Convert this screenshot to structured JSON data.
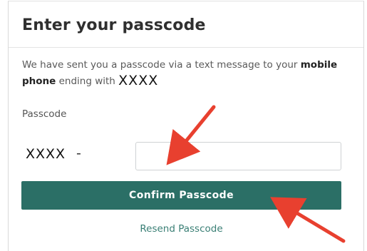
{
  "dialog": {
    "title": "Enter your passcode",
    "message_prefix": "We have sent you a passcode via a text message to your ",
    "message_bold": "mobile phone",
    "message_mid": " ending with ",
    "masked_number": "XXXX"
  },
  "form": {
    "passcode_label": "Passcode",
    "prefix_value": "XXXX",
    "prefix_separator": "-",
    "passcode_value": "",
    "passcode_placeholder": ""
  },
  "actions": {
    "confirm_label": "Confirm Passcode",
    "resend_label": "Resend Passcode"
  },
  "colors": {
    "button_bg": "#2b6f66",
    "link": "#3a7f75",
    "annotation_arrow": "#e8402f"
  },
  "icons": {
    "annotation_1": "red-arrow-icon",
    "annotation_2": "red-arrow-icon"
  }
}
